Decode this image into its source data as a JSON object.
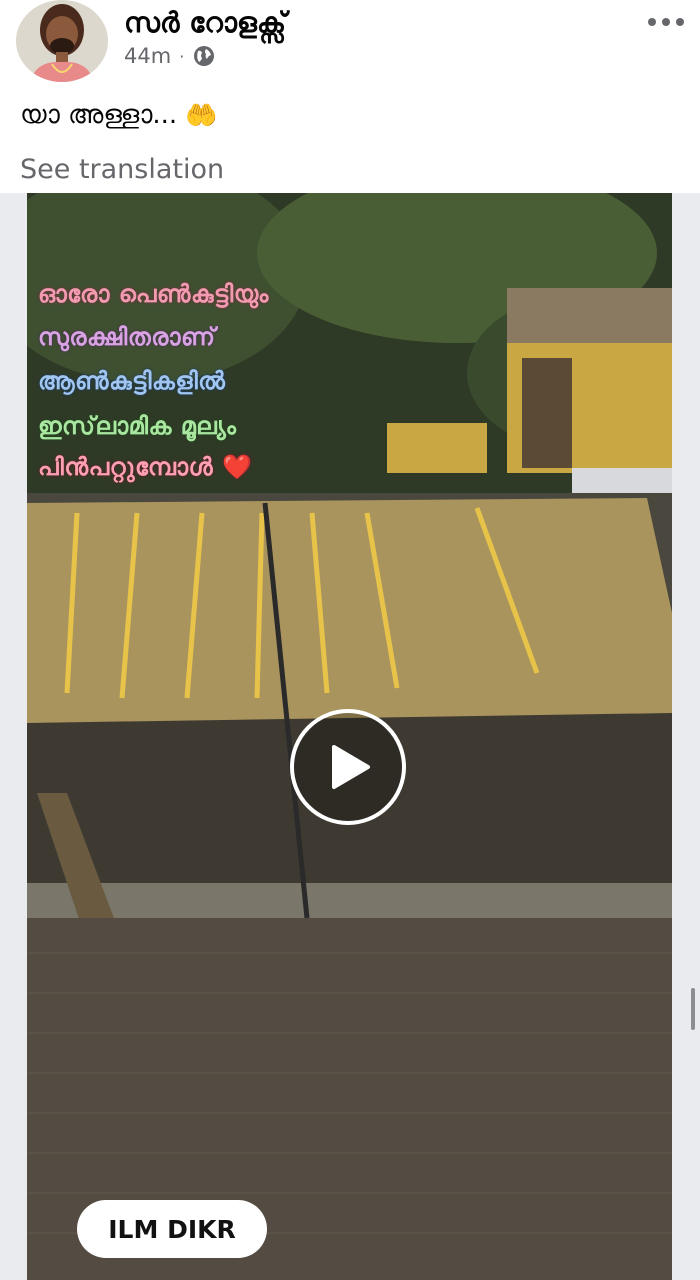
{
  "post": {
    "author": {
      "name": "സർ റോളക്സ്",
      "avatar": "avatar-photo"
    },
    "meta": {
      "time": "44m",
      "separator": "·",
      "privacy_icon": "globe-icon"
    },
    "more_icon": "more-options-icon",
    "text": "യാ അള്ളാ...",
    "text_emoji": "🤲",
    "see_translation": "See translation"
  },
  "media": {
    "overlay_lines": [
      "ഓരോ പെൺകുട്ടിയും",
      "സുരക്ഷിതരാണ്",
      "ആൺകുട്ടികളിൽ",
      "ഇസ്‌ലാമിക മൂല്യം",
      "പിൻപറ്റുമ്പോൾ"
    ],
    "overlay_emoji": "❤️",
    "play_icon": "play-icon",
    "channel_badge": "ILM DIKR"
  },
  "colors": {
    "name_text": "#050505",
    "meta_text": "#65676b",
    "line_1": "#f29ab0",
    "line_2": "#d9a3e3",
    "line_3": "#9fc5f0",
    "line_4": "#a9e6a0",
    "line_5": "#ff9fb3"
  }
}
